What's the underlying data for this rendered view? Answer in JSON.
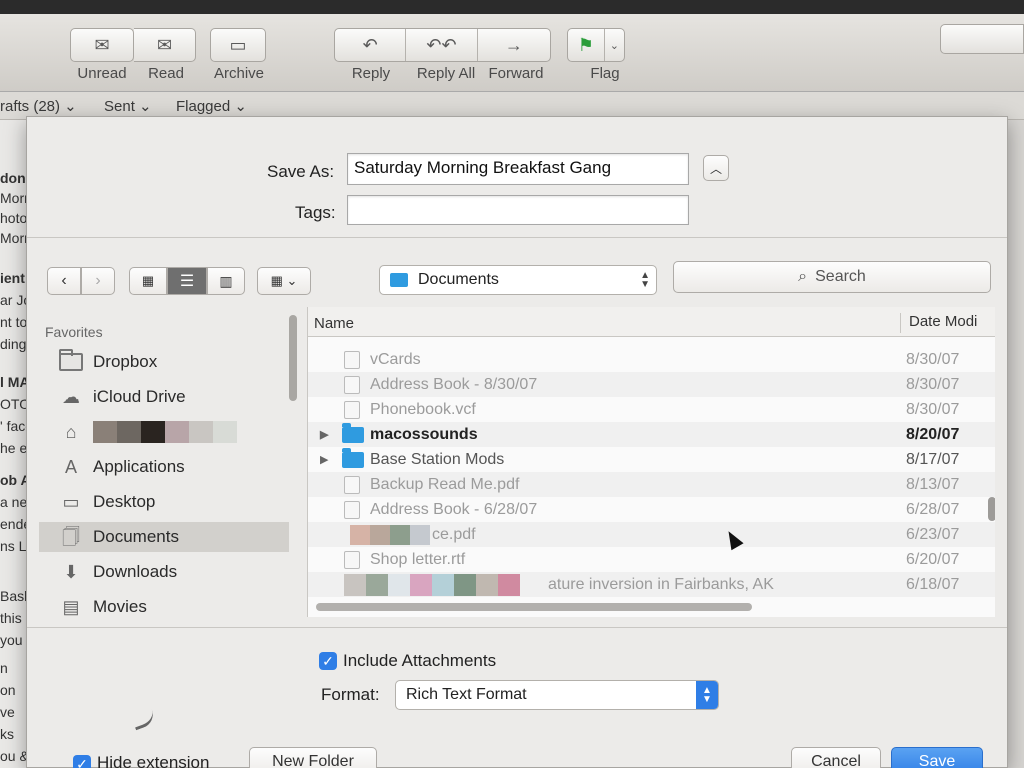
{
  "toolbar": {
    "unread": "Unread",
    "read": "Read",
    "archive": "Archive",
    "reply": "Reply",
    "reply_all": "Reply All",
    "forward": "Forward",
    "flag": "Flag"
  },
  "favorites_bar": {
    "drafts": "rafts (28) ⌄",
    "sent": "Sent ⌄",
    "flagged": "Flagged ⌄"
  },
  "mail_list_fragments": [
    "don",
    "Morn",
    "hoto",
    "Morn",
    "ient",
    "ar Jo",
    "nt to",
    "ding",
    "l MA",
    "OTON",
    "' face",
    "he els",
    "ob Al",
    "a new",
    "ended",
    "ns Lea",
    "Basl",
    "this se",
    "you",
    "n",
    "on",
    "ve",
    "ks",
    "ou &"
  ],
  "dialog": {
    "save_as_label": "Save As:",
    "save_as_value": "Saturday Morning Breakfast Gang",
    "tags_label": "Tags:",
    "tags_value": "",
    "location": "Documents",
    "search_placeholder": "Search",
    "sidebar": {
      "heading": "Favorites",
      "items": [
        {
          "label": "Dropbox",
          "icon": "folder-icon"
        },
        {
          "label": "iCloud Drive",
          "icon": "cloud-icon"
        },
        {
          "label": "",
          "icon": "home-icon"
        },
        {
          "label": "Applications",
          "icon": "applications-icon"
        },
        {
          "label": "Desktop",
          "icon": "desktop-icon"
        },
        {
          "label": "Documents",
          "icon": "documents-icon"
        },
        {
          "label": "Downloads",
          "icon": "downloads-icon"
        },
        {
          "label": "Movies",
          "icon": "movies-icon"
        }
      ]
    },
    "columns": {
      "name": "Name",
      "date": "Date Modi"
    },
    "files": [
      {
        "name": "vCards",
        "date": "8/30/07",
        "kind": "file",
        "style": "dim"
      },
      {
        "name": "Address Book - 8/30/07",
        "date": "8/30/07",
        "kind": "file",
        "style": "dim"
      },
      {
        "name": "Phonebook.vcf",
        "date": "8/30/07",
        "kind": "file",
        "style": "dim"
      },
      {
        "name": "macossounds",
        "date": "8/20/07",
        "kind": "folder",
        "style": "bold"
      },
      {
        "name": "Base Station Mods",
        "date": "8/17/07",
        "kind": "folder",
        "style": "normal"
      },
      {
        "name": "Backup Read Me.pdf",
        "date": "8/13/07",
        "kind": "file",
        "style": "dim"
      },
      {
        "name": "Address Book - 6/28/07",
        "date": "6/28/07",
        "kind": "file",
        "style": "dim"
      },
      {
        "name": "ce.pdf",
        "date": "6/23/07",
        "kind": "file",
        "style": "dim"
      },
      {
        "name": "Shop letter.rtf",
        "date": "6/20/07",
        "kind": "file",
        "style": "dim"
      },
      {
        "name": "ature inversion in Fairbanks, AK",
        "date": "6/18/07",
        "kind": "file",
        "style": "dim"
      }
    ],
    "include_attachments_label": "Include Attachments",
    "include_attachments_checked": true,
    "format_label": "Format:",
    "format_value": "Rich Text Format",
    "hide_extension_label": "Hide extension",
    "new_folder_label": "New Folder",
    "cancel_label": "Cancel",
    "save_label": "Save"
  },
  "colors": {
    "accent": "#2f7ee6",
    "folder": "#2f9be0",
    "flag": "#2a9d3a"
  }
}
